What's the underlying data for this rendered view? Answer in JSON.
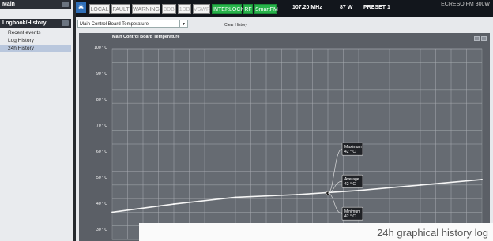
{
  "sidebar": {
    "section1_title": "Main",
    "section2_title": "Logbook/History",
    "items": [
      "Recent events",
      "Log History",
      "24h History"
    ]
  },
  "topbar": {
    "badges": [
      "LOCAL",
      "FAULT",
      "WARNING",
      "3DB",
      "1DB",
      "VSWR",
      "INTERLOCK",
      "RF",
      "SmartFM"
    ],
    "frequency": "107.20 MHz",
    "power": "87 W",
    "preset": "PRESET 1",
    "brand": "ECRESO FM 300W"
  },
  "controls": {
    "selected_sensor": "Main Control Board Temperature",
    "clear_history": "Clear History"
  },
  "chart_data": {
    "type": "line",
    "title": "Main Control Board Temperature",
    "ylabels": [
      "100 ° C",
      "90 ° C",
      "80 ° C",
      "70 ° C",
      "60 ° C",
      "50 ° C",
      "40 ° C",
      "30 ° C"
    ],
    "ylim": [
      30,
      100
    ],
    "grid": true,
    "series": [
      {
        "x": [
          0,
          4,
          8,
          12,
          16,
          20,
          24
        ],
        "values": [
          40,
          43,
          45.5,
          46.5,
          48,
          50,
          52
        ]
      }
    ],
    "annotations": [
      {
        "label": "Maximum",
        "value": "42 ° C"
      },
      {
        "label": "Average",
        "value": "42 ° C"
      },
      {
        "label": "Minimum",
        "value": "42 ° C"
      }
    ]
  },
  "caption": "24h graphical history log"
}
